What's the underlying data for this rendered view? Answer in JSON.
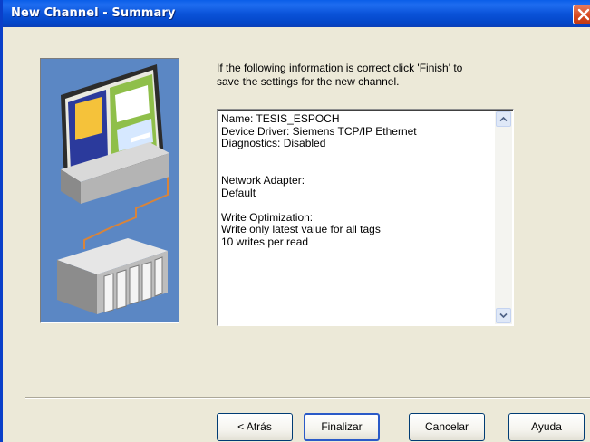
{
  "window": {
    "title": "New Channel - Summary"
  },
  "intro": {
    "line1": "If the following information is correct click 'Finish' to",
    "line2": "save the settings for the new channel."
  },
  "summary": {
    "lines": [
      "Name: TESIS_ESPOCH",
      "Device Driver: Siemens TCP/IP Ethernet",
      "Diagnostics: Disabled",
      "",
      "",
      "Network Adapter:",
      "Default",
      "",
      "Write Optimization:",
      "Write only latest value for all tags",
      "10 writes per read"
    ]
  },
  "buttons": {
    "back": "< Atrás",
    "finish": "Finalizar",
    "cancel": "Cancelar",
    "help": "Ayuda"
  },
  "colors": {
    "titlebar": "#0a53d9",
    "dialog_bg": "#ece9d8",
    "illustration_bg": "#5b87c4"
  }
}
